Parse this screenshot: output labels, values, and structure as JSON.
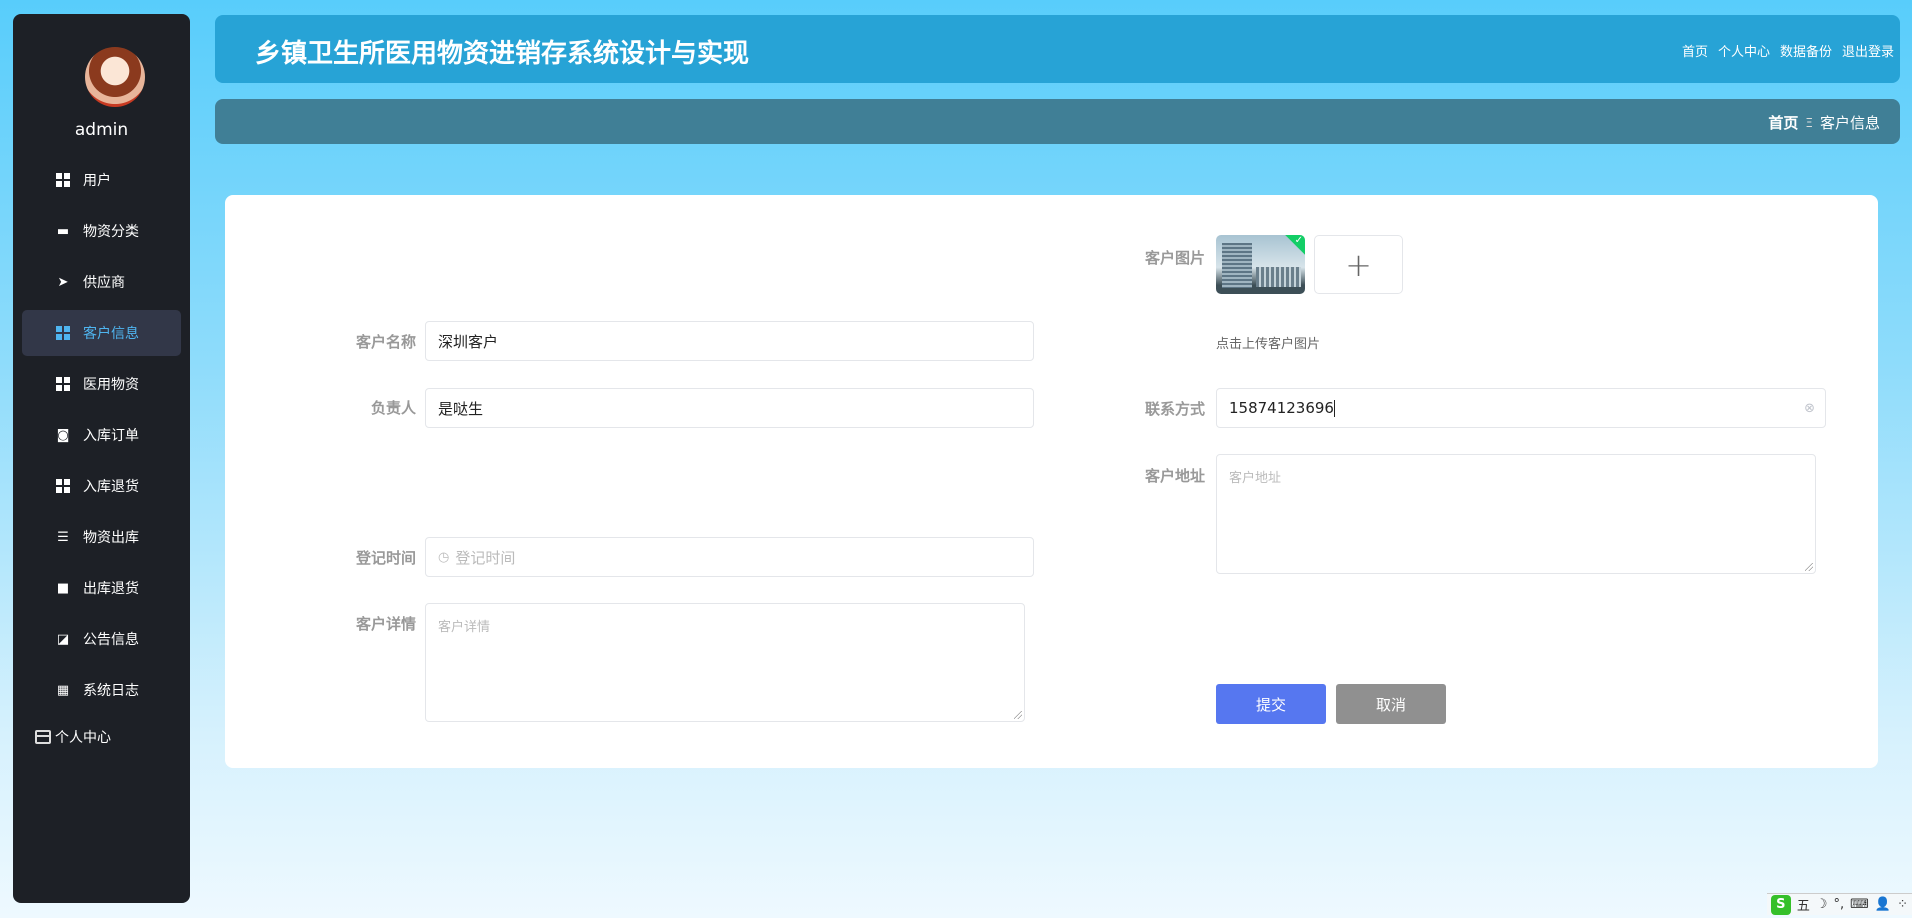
{
  "user": {
    "name": "admin"
  },
  "sidebar": {
    "items": [
      {
        "label": "用户",
        "icon": "grid-icon"
      },
      {
        "label": "物资分类",
        "icon": "ticket-icon"
      },
      {
        "label": "供应商",
        "icon": "send-icon"
      },
      {
        "label": "客户信息",
        "icon": "grid-icon",
        "active": true
      },
      {
        "label": "医用物资",
        "icon": "grid-icon"
      },
      {
        "label": "入库订单",
        "icon": "wallet-icon"
      },
      {
        "label": "入库退货",
        "icon": "grid-icon"
      },
      {
        "label": "物资出库",
        "icon": "sliders-icon"
      },
      {
        "label": "出库退货",
        "icon": "briefcase-icon"
      },
      {
        "label": "公告信息",
        "icon": "chart-icon"
      },
      {
        "label": "系统日志",
        "icon": "table-icon"
      }
    ],
    "personal": "个人中心"
  },
  "header": {
    "title": "乡镇卫生所医用物资进销存系统设计与实现",
    "links": [
      "首页",
      "个人中心",
      "数据备份",
      "退出登录"
    ]
  },
  "breadcrumb": {
    "home": "首页",
    "separator": "Ξ",
    "current": "客户信息"
  },
  "form": {
    "name": {
      "label": "客户名称",
      "value": "深圳客户"
    },
    "manager": {
      "label": "负责人",
      "value": "是哒生"
    },
    "reg_time": {
      "label": "登记时间",
      "placeholder": "登记时间"
    },
    "detail": {
      "label": "客户详情",
      "placeholder": "客户详情"
    },
    "image": {
      "label": "客户图片",
      "hint": "点击上传客户图片",
      "add": "+"
    },
    "contact": {
      "label": "联系方式",
      "value": "15874123696"
    },
    "address": {
      "label": "客户地址",
      "placeholder": "客户地址"
    },
    "submit": "提交",
    "cancel": "取消"
  },
  "ime": {
    "logo": "S",
    "mode": "五",
    "items": [
      "☽",
      "°,",
      "⌨",
      "👤",
      "⁘"
    ]
  },
  "colors": {
    "primary": "#5677f0",
    "cancel": "#909090",
    "header": "#27a3d6",
    "breadcrumb": "#407f96",
    "sidebar": "#1d2026",
    "active": "#4fb5f0"
  }
}
